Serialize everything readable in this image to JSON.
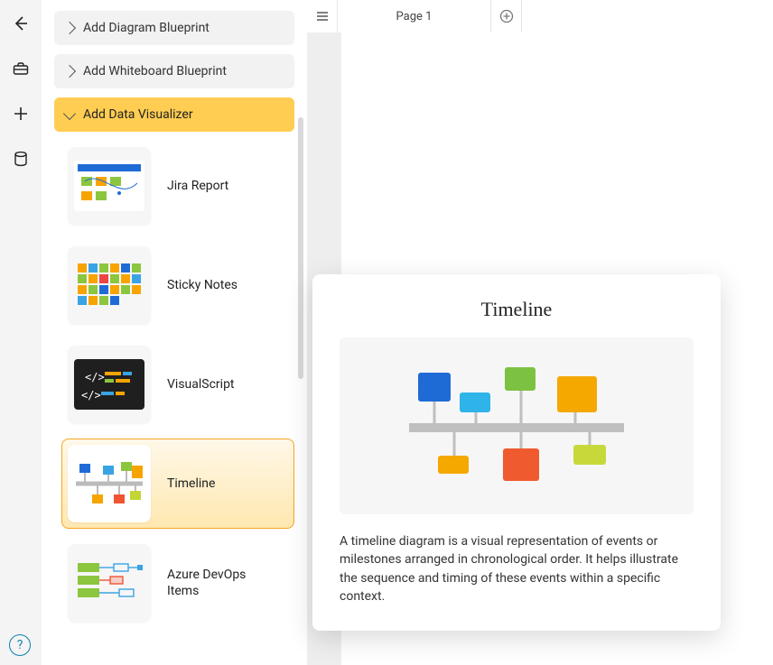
{
  "rail": {
    "back": "Back",
    "toolbox": "Toolbox",
    "add": "Add",
    "data": "Data"
  },
  "sidebar": {
    "accordion": [
      {
        "label": "Add Diagram Blueprint",
        "expanded": false
      },
      {
        "label": "Add Whiteboard Blueprint",
        "expanded": false
      },
      {
        "label": "Add Data Visualizer",
        "expanded": true
      }
    ],
    "visualizers": [
      {
        "id": "jira-report",
        "label": "Jira Report",
        "selected": false
      },
      {
        "id": "sticky-notes",
        "label": "Sticky Notes",
        "selected": false
      },
      {
        "id": "visualscript",
        "label": "VisualScript",
        "selected": false
      },
      {
        "id": "timeline",
        "label": "Timeline",
        "selected": true
      },
      {
        "id": "azure-devops",
        "label": "Azure DevOps Items",
        "selected": false
      }
    ]
  },
  "tabs": {
    "page1": "Page 1"
  },
  "tooltip": {
    "title": "Timeline",
    "description": "A timeline diagram is a visual representation of events or milestones arranged in chronological order. It helps illustrate the sequence and timing of these events within a specific context."
  },
  "help": "?"
}
